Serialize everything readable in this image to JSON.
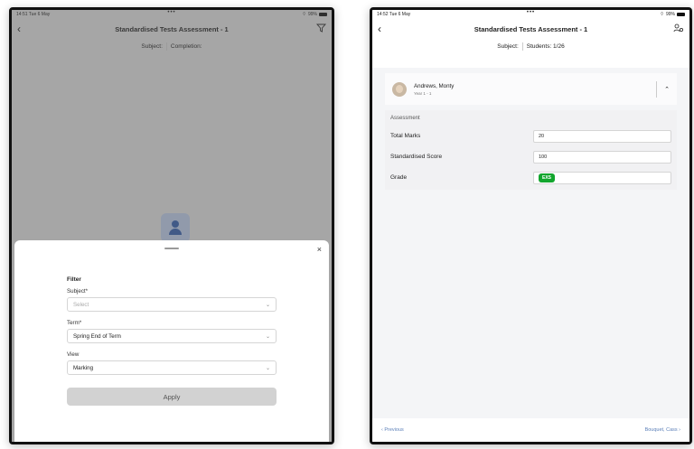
{
  "left": {
    "status": {
      "time": "14:51  Tue 6 May",
      "dots": "•••",
      "battery": "99%"
    },
    "nav": {
      "back": "‹",
      "title": "Standardised Tests Assessment  - 1"
    },
    "subbar": {
      "subject": "Subject:",
      "completion": "Completion:"
    },
    "sheet": {
      "close": "×",
      "heading": "Filter",
      "subject_label": "Subject*",
      "subject_placeholder": "Select",
      "term_label": "Term*",
      "term_value": "Spring End of Term",
      "view_label": "View",
      "view_value": "Marking",
      "apply_label": "Apply"
    }
  },
  "right": {
    "status": {
      "time": "14:52  Tue 6 May",
      "dots": "•••",
      "battery": "99%"
    },
    "nav": {
      "back": "‹",
      "title": "Standardised Tests Assessment  - 1"
    },
    "subbar": {
      "subject": "Subject:",
      "students": "Students: 1/26"
    },
    "student": {
      "name": "Andrews, Monty",
      "year": "Year 1 - 1"
    },
    "assessment": {
      "heading": "Assessment",
      "rows": [
        {
          "label": "Total Marks",
          "value": "20"
        },
        {
          "label": "Standardised Score",
          "value": "100"
        },
        {
          "label": "Grade",
          "value": "EXS"
        }
      ]
    },
    "footer": {
      "previous": "‹  Previous",
      "next": "Bouquet, Cass  ›"
    }
  }
}
